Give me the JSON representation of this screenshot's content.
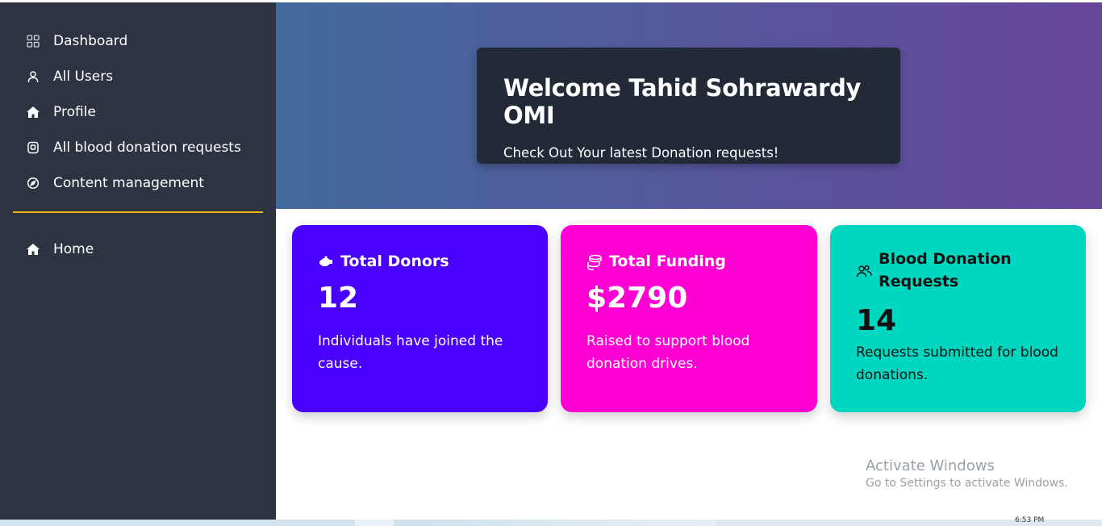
{
  "sidebar": {
    "items": [
      {
        "label": "Dashboard",
        "icon": "grid-icon"
      },
      {
        "label": "All Users",
        "icon": "user-icon"
      },
      {
        "label": "Profile",
        "icon": "home-icon"
      },
      {
        "label": "All blood donation requests",
        "icon": "request-icon"
      },
      {
        "label": "Content management",
        "icon": "compass-icon"
      }
    ],
    "divider_color": "#f2b705",
    "bottom_items": [
      {
        "label": "Home",
        "icon": "home-icon"
      }
    ]
  },
  "hero": {
    "title": "Welcome Tahid Sohrawardy OMI",
    "subtitle": "Check Out Your latest Donation requests!"
  },
  "cards": [
    {
      "title": "Total Donors",
      "value": "12",
      "description": "Individuals have joined the cause.",
      "icon": "donors-icon",
      "color": "#4a00ff"
    },
    {
      "title": "Total Funding",
      "value": "$2790",
      "description": "Raised to support blood donation drives.",
      "icon": "coins-icon",
      "color": "#ff00d3"
    },
    {
      "title": "Blood Donation Requests",
      "value": "14",
      "description": "Requests submitted for blood donations.",
      "icon": "users-icon",
      "color": "#00d7c0"
    }
  ],
  "watermark": {
    "title": "Activate Windows",
    "subtitle": "Go to Settings to activate Windows."
  },
  "taskbar": {
    "clock": "6:53 PM"
  }
}
